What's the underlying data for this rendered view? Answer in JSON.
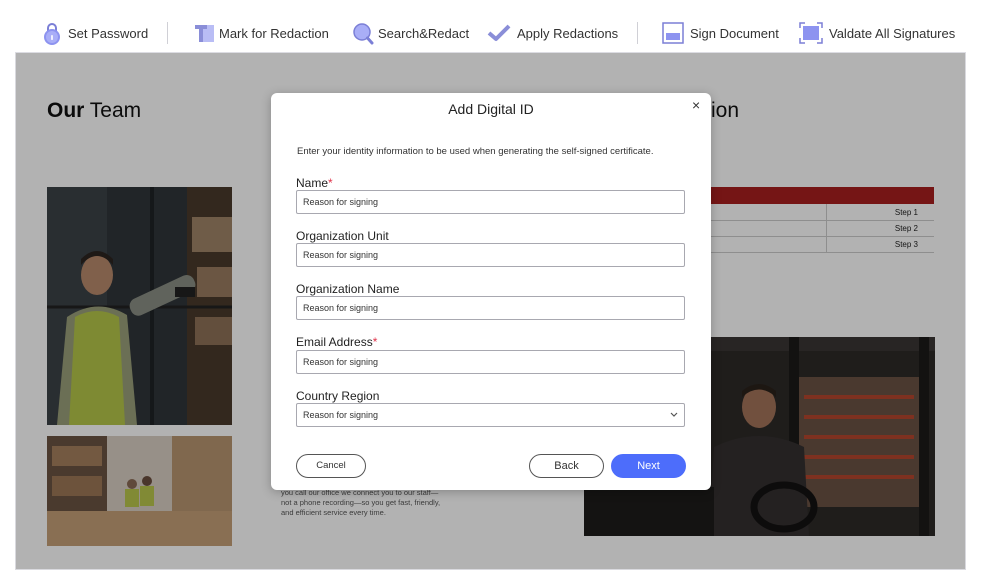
{
  "toolbar": {
    "set_password": "Set Password",
    "mark_redaction": "Mark for Redaction",
    "search_redact": "Search&Redact",
    "apply_redactions": "Apply Redactions",
    "sign_document": "Sign Document",
    "validate_signatures": "Valdate All Signatures"
  },
  "document": {
    "title_bold": "Our",
    "title_rest": " Team",
    "title2_tail": "ion",
    "steps": [
      "Step 1",
      "Step 2",
      "Step 3"
    ],
    "paragraph": "you call our office we connect you to our staff—not a phone recording—so you get fast, friendly, and efficient service every time.",
    "accent_color": "#a81f1f"
  },
  "modal": {
    "title": "Add Digital ID",
    "close": "×",
    "instruction": "Enter your identity information to be used when generating the self-signed certificate.",
    "fields": [
      {
        "label": "Name",
        "required": "*",
        "value": "Reason for signing"
      },
      {
        "label": "Organization Unit",
        "required": "",
        "value": "Reason for signing"
      },
      {
        "label": "Organization Name",
        "required": "",
        "value": "Reason for signing"
      },
      {
        "label": "Email Address",
        "required": "*",
        "value": "Reason for signing"
      },
      {
        "label": "Country Region",
        "required": "",
        "value": "Reason for signing"
      }
    ],
    "dropdown_chevron": "⌄",
    "cancel": "Cancel",
    "back": "Back",
    "next": "Next",
    "primary_color": "#4d6dfb"
  }
}
